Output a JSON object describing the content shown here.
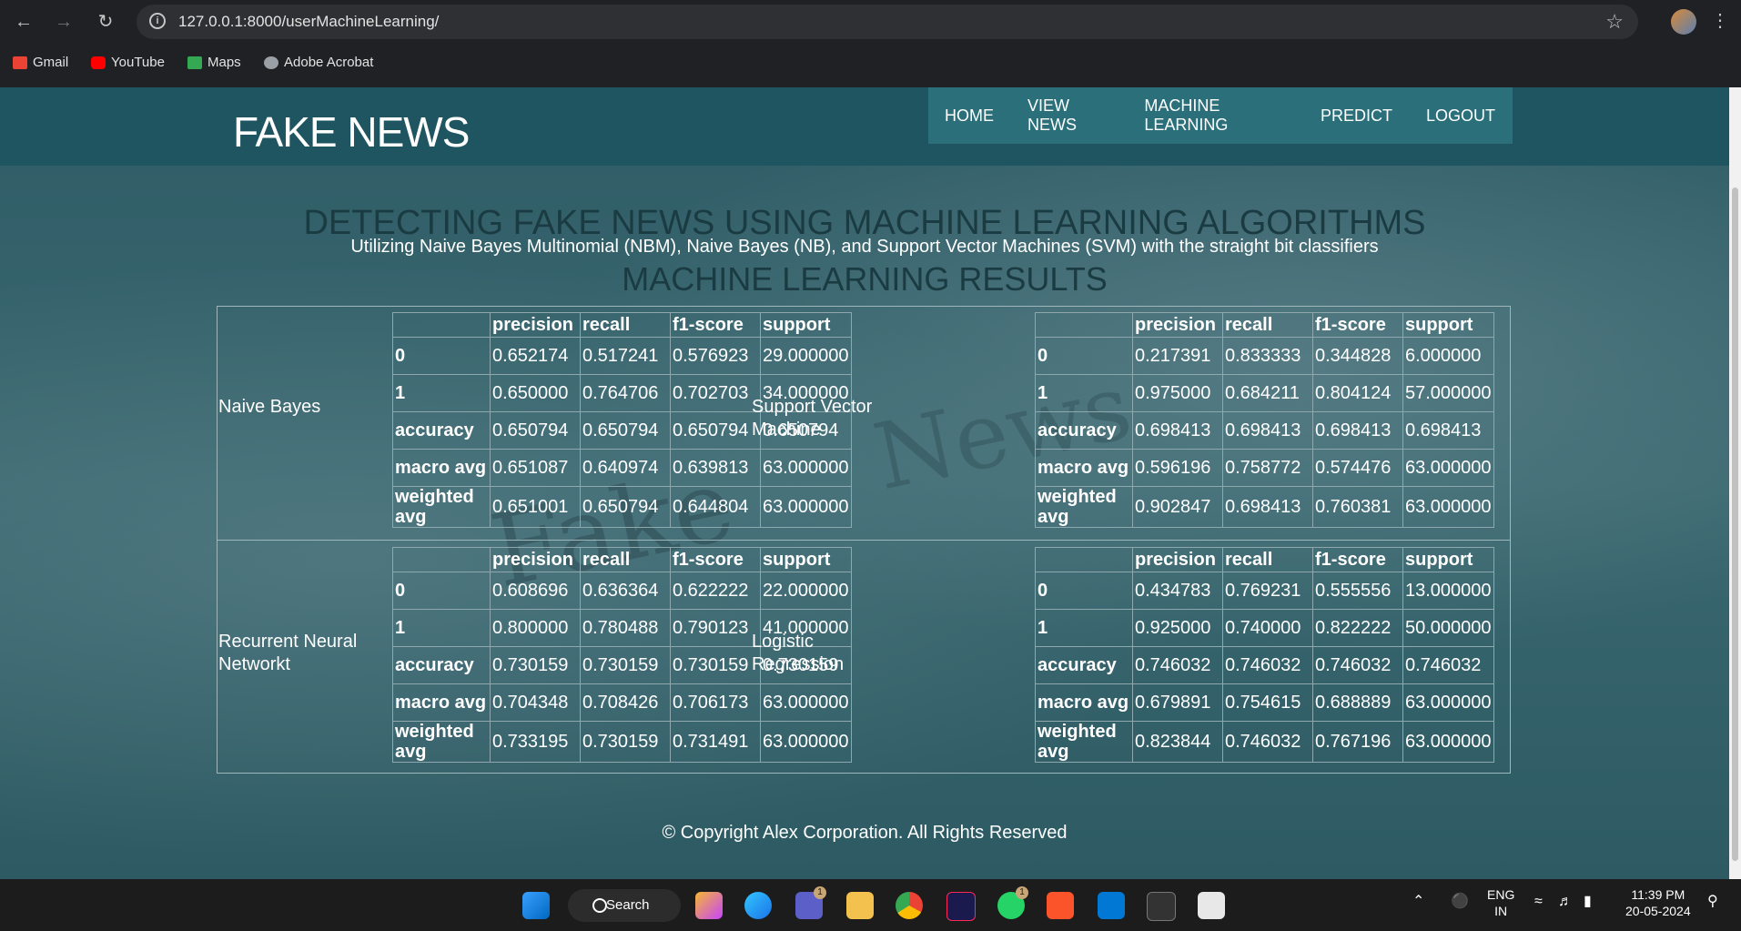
{
  "browser": {
    "url": "127.0.0.1:8000/userMachineLearning/",
    "bookmarks": [
      {
        "label": "Gmail",
        "color": "#ea4335"
      },
      {
        "label": "YouTube",
        "color": "#ff0000"
      },
      {
        "label": "Maps",
        "color": "#34a853"
      },
      {
        "label": "Adobe Acrobat",
        "color": "#9aa0a6"
      }
    ]
  },
  "site": {
    "logo": "FAKE NEWS",
    "nav": [
      "HOME",
      "VIEW NEWS",
      "MACHINE LEARNING",
      "PREDICT",
      "LOGOUT"
    ],
    "background_word": "Fake News"
  },
  "heading": {
    "title": "DETECTING FAKE NEWS USING MACHINE LEARNING ALGORITHMS",
    "subtitle": "Utilizing Naive Bayes Multinomial (NBM), Naive Bayes (NB), and Support Vector Machines (SVM) with the straight bit classifiers",
    "section": "MACHINE LEARNING RESULTS"
  },
  "columns": [
    "precision",
    "recall",
    "f1-score",
    "support"
  ],
  "row_labels": [
    "0",
    "1",
    "accuracy",
    "macro avg",
    "weighted avg"
  ],
  "models": [
    {
      "name": "Naive Bayes",
      "rows": [
        [
          "0.652174",
          "0.517241",
          "0.576923",
          "29.000000"
        ],
        [
          "0.650000",
          "0.764706",
          "0.702703",
          "34.000000"
        ],
        [
          "0.650794",
          "0.650794",
          "0.650794",
          "0.650794"
        ],
        [
          "0.651087",
          "0.640974",
          "0.639813",
          "63.000000"
        ],
        [
          "0.651001",
          "0.650794",
          "0.644804",
          "63.000000"
        ]
      ]
    },
    {
      "name": "Support Vector Machine",
      "rows": [
        [
          "0.217391",
          "0.833333",
          "0.344828",
          "6.000000"
        ],
        [
          "0.975000",
          "0.684211",
          "0.804124",
          "57.000000"
        ],
        [
          "0.698413",
          "0.698413",
          "0.698413",
          "0.698413"
        ],
        [
          "0.596196",
          "0.758772",
          "0.574476",
          "63.000000"
        ],
        [
          "0.902847",
          "0.698413",
          "0.760381",
          "63.000000"
        ]
      ]
    },
    {
      "name": "Recurrent Neural Networkt",
      "rows": [
        [
          "0.608696",
          "0.636364",
          "0.622222",
          "22.000000"
        ],
        [
          "0.800000",
          "0.780488",
          "0.790123",
          "41.000000"
        ],
        [
          "0.730159",
          "0.730159",
          "0.730159",
          "0.730159"
        ],
        [
          "0.704348",
          "0.708426",
          "0.706173",
          "63.000000"
        ],
        [
          "0.733195",
          "0.730159",
          "0.731491",
          "63.000000"
        ]
      ]
    },
    {
      "name": "Logistic Regression",
      "rows": [
        [
          "0.434783",
          "0.769231",
          "0.555556",
          "13.000000"
        ],
        [
          "0.925000",
          "0.740000",
          "0.822222",
          "50.000000"
        ],
        [
          "0.746032",
          "0.746032",
          "0.746032",
          "0.746032"
        ],
        [
          "0.679891",
          "0.754615",
          "0.688889",
          "63.000000"
        ],
        [
          "0.823844",
          "0.746032",
          "0.767196",
          "63.000000"
        ]
      ]
    }
  ],
  "footer": "© Copyright Alex Corporation. All Rights Reserved",
  "taskbar": {
    "search_label": "Search",
    "badges": {
      "teams": "1",
      "whatsapp": "1"
    },
    "lang_top": "ENG",
    "lang_bottom": "IN",
    "time": "11:39 PM",
    "date": "20-05-2024"
  }
}
